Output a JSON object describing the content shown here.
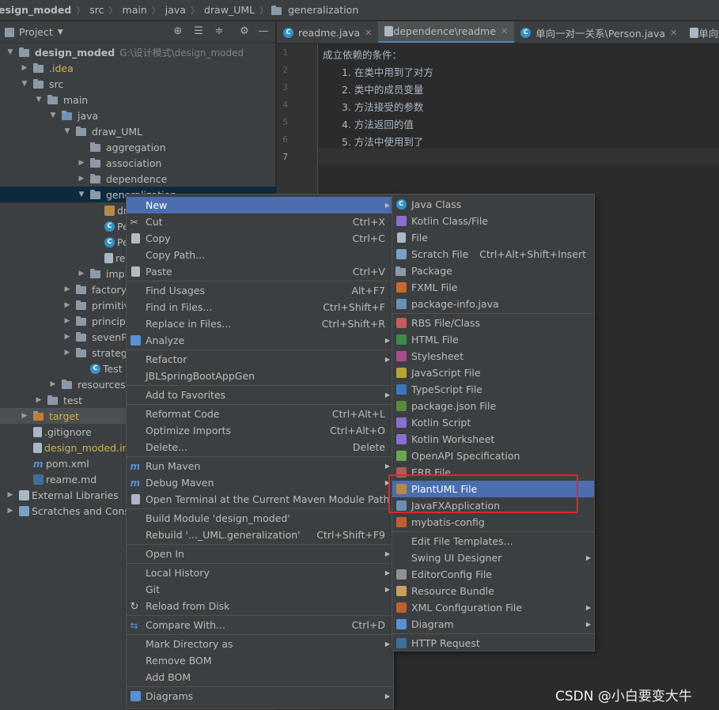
{
  "breadcrumb": [
    "esign_moded",
    "src",
    "main",
    "java",
    "draw_UML",
    "generalization"
  ],
  "project_panel": {
    "title": "Project",
    "tree": [
      {
        "label": "design_moded",
        "path": "G:\\设计模式\\design_moded",
        "indent": 0,
        "arrow": "down",
        "icon": "module",
        "bold": true
      },
      {
        "label": ".idea",
        "indent": 1,
        "arrow": "right",
        "icon": "folder",
        "yellow": true
      },
      {
        "label": "src",
        "indent": 1,
        "arrow": "down",
        "icon": "folder"
      },
      {
        "label": "main",
        "indent": 2,
        "arrow": "down",
        "icon": "folder"
      },
      {
        "label": "java",
        "indent": 3,
        "arrow": "down",
        "icon": "folder-blue"
      },
      {
        "label": "draw_UML",
        "indent": 4,
        "arrow": "down",
        "icon": "package"
      },
      {
        "label": "aggregation",
        "indent": 5,
        "arrow": "",
        "icon": "package"
      },
      {
        "label": "association",
        "indent": 5,
        "arrow": "right",
        "icon": "package"
      },
      {
        "label": "dependence",
        "indent": 5,
        "arrow": "right",
        "icon": "package"
      },
      {
        "label": "generalization",
        "indent": 5,
        "arrow": "down",
        "icon": "package",
        "selected": true
      },
      {
        "label": "dr",
        "indent": 6,
        "arrow": "",
        "icon": "puml"
      },
      {
        "label": "Pe",
        "indent": 6,
        "arrow": "",
        "icon": "class"
      },
      {
        "label": "Pe",
        "indent": 6,
        "arrow": "",
        "icon": "class"
      },
      {
        "label": "re",
        "indent": 6,
        "arrow": "",
        "icon": "file"
      },
      {
        "label": "imple",
        "indent": 5,
        "arrow": "right",
        "icon": "package"
      },
      {
        "label": "factory_",
        "indent": 4,
        "arrow": "right",
        "icon": "package"
      },
      {
        "label": "primitive",
        "indent": 4,
        "arrow": "right",
        "icon": "package"
      },
      {
        "label": "principle",
        "indent": 4,
        "arrow": "right",
        "icon": "package"
      },
      {
        "label": "sevenPr",
        "indent": 4,
        "arrow": "right",
        "icon": "package"
      },
      {
        "label": "strategy",
        "indent": 4,
        "arrow": "right",
        "icon": "package"
      },
      {
        "label": "Test",
        "indent": 5,
        "arrow": "",
        "icon": "class"
      },
      {
        "label": "resources",
        "indent": 3,
        "arrow": "right",
        "icon": "folder"
      },
      {
        "label": "test",
        "indent": 2,
        "arrow": "right",
        "icon": "folder"
      },
      {
        "label": "target",
        "indent": 1,
        "arrow": "right",
        "icon": "folder-orange",
        "yellow": true,
        "selected_light": true
      },
      {
        "label": ".gitignore",
        "indent": 1,
        "arrow": "",
        "icon": "file"
      },
      {
        "label": "design_moded.im",
        "indent": 1,
        "arrow": "",
        "icon": "file",
        "yellow": true
      },
      {
        "label": "pom.xml",
        "indent": 1,
        "arrow": "",
        "icon": "maven"
      },
      {
        "label": "reame.md",
        "indent": 1,
        "arrow": "",
        "icon": "md"
      },
      {
        "label": "External Libraries",
        "indent": 0,
        "arrow": "right",
        "icon": "lib"
      },
      {
        "label": "Scratches and Conso",
        "indent": 0,
        "arrow": "right",
        "icon": "scratch"
      }
    ]
  },
  "tabs": [
    {
      "label": "readme.java",
      "icon": "class",
      "active": false
    },
    {
      "label": "dependence\\readme",
      "icon": "file",
      "active": true
    },
    {
      "label": "单向一对一关系\\Person.java",
      "icon": "class",
      "active": false
    },
    {
      "label": "单向一",
      "icon": "file",
      "active": false
    }
  ],
  "editor": {
    "line_numbers": [
      "1",
      "2",
      "3",
      "4",
      "5",
      "6",
      "7"
    ],
    "lines": [
      "成立依赖的条件：",
      "1. 在类中用到了对方",
      "2. 类中的成员变量",
      "3. 方法接受的参数",
      "4. 方法返回的值",
      "5. 方法中使用到了",
      ""
    ]
  },
  "context_menu": [
    {
      "label": "New",
      "submenu": true,
      "highlight": true
    },
    {
      "label": "Cut",
      "shortcut": "Ctrl+X",
      "icon": "cut"
    },
    {
      "label": "Copy",
      "shortcut": "Ctrl+C",
      "icon": "copy"
    },
    {
      "label": "Copy Path...",
      "shortcut": ""
    },
    {
      "label": "Paste",
      "shortcut": "Ctrl+V",
      "icon": "paste"
    },
    {
      "sep": true
    },
    {
      "label": "Find Usages",
      "shortcut": "Alt+F7"
    },
    {
      "label": "Find in Files...",
      "shortcut": "Ctrl+Shift+F"
    },
    {
      "label": "Replace in Files...",
      "shortcut": "Ctrl+Shift+R"
    },
    {
      "label": "Analyze",
      "submenu": true,
      "icon": "analyze"
    },
    {
      "sep": true
    },
    {
      "label": "Refactor",
      "submenu": true
    },
    {
      "label": "JBLSpringBootAppGen"
    },
    {
      "sep": true
    },
    {
      "label": "Add to Favorites",
      "submenu": true
    },
    {
      "sep": true
    },
    {
      "label": "Reformat Code",
      "shortcut": "Ctrl+Alt+L"
    },
    {
      "label": "Optimize Imports",
      "shortcut": "Ctrl+Alt+O"
    },
    {
      "label": "Delete...",
      "shortcut": "Delete"
    },
    {
      "sep": true
    },
    {
      "label": "Run Maven",
      "submenu": true,
      "icon": "maven"
    },
    {
      "label": "Debug Maven",
      "submenu": true,
      "icon": "maven"
    },
    {
      "label": "Open Terminal at the Current Maven Module Path",
      "icon": "terminal"
    },
    {
      "sep": true
    },
    {
      "label": "Build Module 'design_moded'"
    },
    {
      "label": "Rebuild '..._UML.generalization'",
      "shortcut": "Ctrl+Shift+F9"
    },
    {
      "sep": true
    },
    {
      "label": "Open In",
      "submenu": true
    },
    {
      "sep": true
    },
    {
      "label": "Local History",
      "submenu": true
    },
    {
      "label": "Git",
      "submenu": true
    },
    {
      "label": "Reload from Disk",
      "icon": "reload"
    },
    {
      "sep": true
    },
    {
      "label": "Compare With...",
      "shortcut": "Ctrl+D",
      "icon": "compare"
    },
    {
      "sep": true
    },
    {
      "label": "Mark Directory as",
      "submenu": true
    },
    {
      "label": "Remove BOM"
    },
    {
      "label": "Add BOM"
    },
    {
      "sep": true
    },
    {
      "label": "Diagrams",
      "submenu": true,
      "icon": "diagram"
    }
  ],
  "new_submenu": [
    {
      "label": "Java Class",
      "icon": "class"
    },
    {
      "label": "Kotlin Class/File",
      "icon": "kotlin"
    },
    {
      "label": "File",
      "icon": "file"
    },
    {
      "label": "Scratch File",
      "shortcut": "Ctrl+Alt+Shift+Insert",
      "icon": "scratch"
    },
    {
      "label": "Package",
      "icon": "package"
    },
    {
      "label": "FXML File",
      "icon": "fxml"
    },
    {
      "label": "package-info.java",
      "icon": "java"
    },
    {
      "sep": true
    },
    {
      "label": "RBS File/Class",
      "icon": "rbs"
    },
    {
      "label": "HTML File",
      "icon": "html"
    },
    {
      "label": "Stylesheet",
      "icon": "css"
    },
    {
      "label": "JavaScript File",
      "icon": "js"
    },
    {
      "label": "TypeScript File",
      "icon": "ts"
    },
    {
      "label": "package.json File",
      "icon": "node"
    },
    {
      "label": "Kotlin Script",
      "icon": "kotlin"
    },
    {
      "label": "Kotlin Worksheet",
      "icon": "kotlin"
    },
    {
      "label": "OpenAPI Specification",
      "icon": "openapi"
    },
    {
      "label": "ERB File",
      "icon": "erb"
    },
    {
      "label": "PlantUML File",
      "icon": "puml",
      "highlight": true
    },
    {
      "label": "JavaFXApplication",
      "icon": "java"
    },
    {
      "label": "mybatis-config",
      "icon": "xml"
    },
    {
      "sep": true
    },
    {
      "label": "Edit File Templates..."
    },
    {
      "label": "Swing UI Designer",
      "submenu": true
    },
    {
      "label": "EditorConfig File",
      "icon": "editorconfig"
    },
    {
      "label": "Resource Bundle",
      "icon": "bundle"
    },
    {
      "label": "XML Configuration File",
      "submenu": true,
      "icon": "xml"
    },
    {
      "label": "Diagram",
      "submenu": true,
      "icon": "diagram"
    },
    {
      "sep": true
    },
    {
      "label": "HTTP Request",
      "icon": "api"
    }
  ],
  "watermark": "CSDN @小白要变大牛",
  "colors": {
    "selection": "#4b6eaf",
    "annotation": "#e0272c",
    "tab_underline": "#4a88c7"
  }
}
